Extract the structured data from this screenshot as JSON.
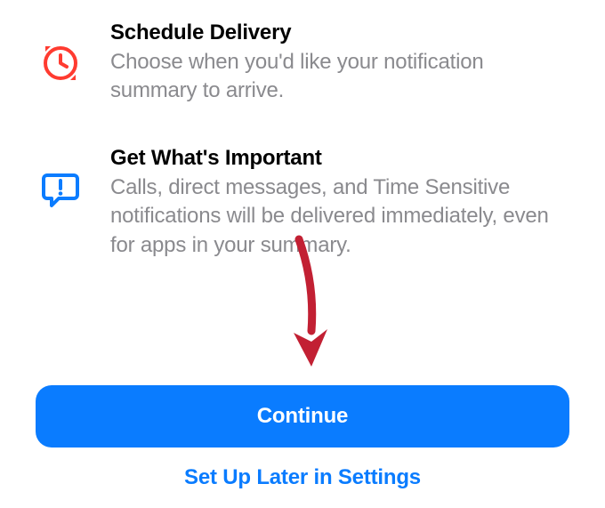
{
  "features": [
    {
      "title": "Schedule Delivery",
      "description": "Choose when you'd like your notification summary to arrive.",
      "icon": "clock-alarm-icon",
      "icon_color": "#ff3b30"
    },
    {
      "title": "Get What's Important",
      "description": "Calls, direct messages, and Time Sensitive notifications will be delivered immediately, even for apps in your summary.",
      "icon": "chat-alert-icon",
      "icon_color": "#0a7cff"
    }
  ],
  "buttons": {
    "primary": "Continue",
    "secondary": "Set Up Later in Settings"
  },
  "colors": {
    "accent": "#0a7cff",
    "danger": "#ff3b30",
    "text_secondary": "#8a8a8e"
  },
  "annotation": {
    "type": "arrow",
    "color": "#c22033",
    "points_to": "continue-button"
  }
}
